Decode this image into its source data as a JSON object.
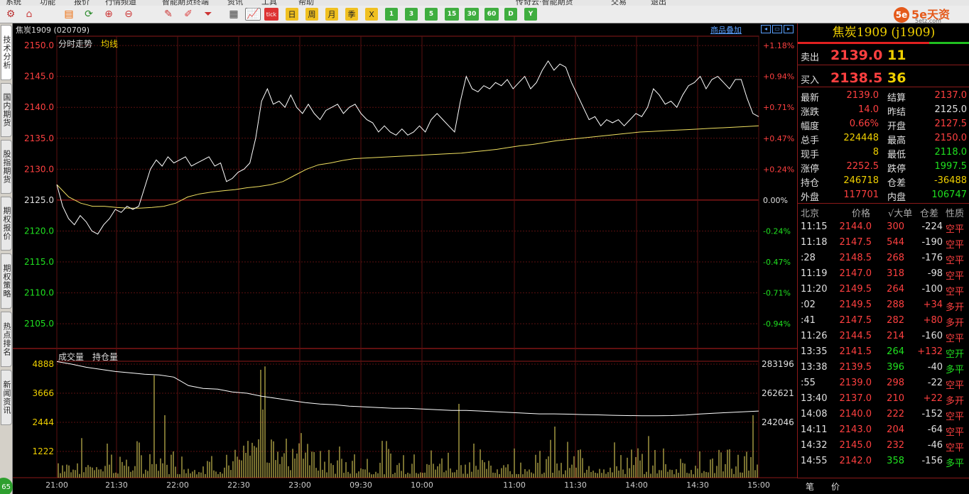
{
  "menu": [
    "系统",
    "功能",
    "报价",
    "行情频道",
    "智能期货终端",
    "资讯",
    "工具",
    "帮助",
    "传奇云·智能期货",
    "交易",
    "退出"
  ],
  "toolbar": {
    "day_buttons": [
      "日",
      "周",
      "月",
      "季",
      "X"
    ],
    "period_buttons": [
      "1",
      "3",
      "5",
      "15",
      "30",
      "60",
      "D",
      "Y"
    ],
    "tick_label": "tick"
  },
  "logo": {
    "circle": "5e",
    "name": "5e天资",
    "site": "5etz.com"
  },
  "left_tabs": [
    "技术分析",
    "国内期货",
    "股指期货",
    "期权报价",
    "期权策略",
    "热点排名",
    "新闻资讯"
  ],
  "left_tab_badge": "65",
  "chart": {
    "contract": "焦炭1909 (020709)",
    "overlay_link": "商品叠加",
    "price_title": "分时走势",
    "avg_label": "均线",
    "vol_title": "成交量",
    "oi_label": "持仓量",
    "price_ticks": [
      "2150.0",
      "2145.0",
      "2140.0",
      "2135.0",
      "2130.0",
      "2125.0",
      "2120.0",
      "2115.0",
      "2110.0",
      "2105.0"
    ],
    "pct_ticks": [
      "+1.18%",
      "+0.94%",
      "+0.71%",
      "+0.47%",
      "+0.24%",
      "0.00%",
      "-0.24%",
      "-0.47%",
      "-0.71%",
      "-0.94%"
    ],
    "vol_ticks": [
      "4888",
      "3666",
      "2444",
      "1222"
    ],
    "oi_ticks": [
      "283196",
      "262621",
      "242046"
    ],
    "time_ticks": [
      "21:00",
      "21:30",
      "22:00",
      "22:30",
      "23:00",
      "09:30",
      "10:00",
      "11:00",
      "11:30",
      "14:00",
      "14:30",
      "15:00"
    ]
  },
  "chart_data": {
    "type": "line",
    "prev_settle": 2125.0,
    "ylim": [
      2101.0,
      2151.5
    ],
    "price_series": [
      2127.5,
      2124.0,
      2122.0,
      2121.0,
      2122.5,
      2121.5,
      2120.0,
      2119.5,
      2121.0,
      2122.0,
      2123.5,
      2123.0,
      2124.0,
      2123.5,
      2124.0,
      2127.0,
      2130.0,
      2131.5,
      2130.5,
      2132.0,
      2131.0,
      2131.5,
      2132.0,
      2130.5,
      2131.0,
      2131.5,
      2132.0,
      2130.5,
      2131.0,
      2128.0,
      2128.5,
      2129.5,
      2130.0,
      2131.0,
      2135.0,
      2141.0,
      2143.0,
      2140.5,
      2141.0,
      2140.0,
      2142.0,
      2140.0,
      2139.0,
      2140.5,
      2139.0,
      2138.0,
      2139.5,
      2140.0,
      2140.5,
      2139.0,
      2140.0,
      2140.5,
      2139.0,
      2138.0,
      2137.5,
      2136.0,
      2137.0,
      2136.0,
      2135.5,
      2136.5,
      2135.5,
      2136.0,
      2137.0,
      2136.0,
      2138.0,
      2139.0,
      2138.0,
      2137.0,
      2136.0,
      2141.0,
      2145.0,
      2143.0,
      2142.5,
      2143.5,
      2143.0,
      2144.0,
      2143.5,
      2144.5,
      2143.0,
      2144.0,
      2145.0,
      2143.0,
      2144.0,
      2146.0,
      2147.5,
      2146.0,
      2147.0,
      2146.5,
      2144.0,
      2142.0,
      2140.0,
      2138.0,
      2138.5,
      2137.0,
      2138.0,
      2137.5,
      2138.0,
      2137.0,
      2138.0,
      2139.0,
      2138.5,
      2140.0,
      2143.0,
      2142.0,
      2140.5,
      2141.0,
      2140.0,
      2142.0,
      2143.5,
      2144.0,
      2145.0,
      2143.0,
      2144.5,
      2145.0,
      2144.0,
      2143.0,
      2144.5,
      2144.5,
      2141.5,
      2139.0,
      2138.5
    ],
    "avg_series": [
      2127.5,
      2125.5,
      2124.5,
      2124.0,
      2124.0,
      2123.8,
      2123.7,
      2123.7,
      2123.8,
      2124.0,
      2124.5,
      2125.5,
      2126.0,
      2126.3,
      2126.5,
      2126.7,
      2127.0,
      2127.2,
      2127.5,
      2128.0,
      2129.0,
      2130.0,
      2130.7,
      2131.0,
      2131.4,
      2131.7,
      2131.8,
      2131.9,
      2132.0,
      2132.1,
      2132.2,
      2132.3,
      2132.4,
      2132.5,
      2132.6,
      2132.8,
      2133.0,
      2133.2,
      2133.5,
      2133.8,
      2134.0,
      2134.3,
      2134.6,
      2134.8,
      2135.0,
      2135.2,
      2135.4,
      2135.6,
      2135.8,
      2136.0,
      2136.1,
      2136.2,
      2136.3,
      2136.4,
      2136.5,
      2136.6,
      2136.7,
      2136.8,
      2136.9,
      2137.0
    ],
    "price_ticks": [
      2150.0,
      2145.0,
      2140.0,
      2135.0,
      2130.0,
      2125.0,
      2120.0,
      2115.0,
      2110.0,
      2105.0
    ],
    "volume_max": 4888,
    "open_interest": [
      285000,
      283196,
      281000,
      279500,
      278000,
      277000,
      276000,
      275500,
      274000,
      268000,
      266000,
      265500,
      263500,
      262621,
      260500,
      259000,
      257500,
      256000,
      255000,
      254500,
      253500,
      253000,
      252500,
      252000,
      252000,
      251500,
      251000,
      250500,
      250500,
      250000,
      249500,
      249000,
      248500,
      248000,
      248000,
      247800,
      247500,
      247300,
      247000,
      246800,
      246700,
      246718,
      246800,
      247200,
      247900,
      248500,
      249000,
      249500,
      250000
    ]
  },
  "quote": {
    "title": "焦炭1909 (j1909)",
    "ask_label": "卖出",
    "ask_price": "2139.0",
    "ask_vol": "11",
    "bid_label": "买入",
    "bid_price": "2138.5",
    "bid_vol": "36",
    "fields": [
      {
        "l": "最新",
        "v": "2139.0",
        "vc": "#ff4040",
        "l2": "结算",
        "v2": "2137.0",
        "v2c": "#ff4040"
      },
      {
        "l": "涨跌",
        "v": "14.0",
        "vc": "#ff4040",
        "l2": "昨结",
        "v2": "2125.0",
        "v2c": "#e0e0e0"
      },
      {
        "l": "幅度",
        "v": "0.66%",
        "vc": "#ff4040",
        "l2": "开盘",
        "v2": "2127.5",
        "v2c": "#ff4040"
      },
      {
        "l": "总手",
        "v": "224448",
        "vc": "#f0d000",
        "l2": "最高",
        "v2": "2150.0",
        "v2c": "#ff4040"
      },
      {
        "l": "现手",
        "v": "8",
        "vc": "#f0d000",
        "l2": "最低",
        "v2": "2118.0",
        "v2c": "#20e020"
      },
      {
        "l": "涨停",
        "v": "2252.5",
        "vc": "#ff4040",
        "l2": "跌停",
        "v2": "1997.5",
        "v2c": "#20e020"
      },
      {
        "l": "持仓",
        "v": "246718",
        "vc": "#f0d000",
        "l2": "仓差",
        "v2": "-36488",
        "v2c": "#f0d000"
      },
      {
        "l": "外盘",
        "v": "117701",
        "vc": "#ff4040",
        "l2": "内盘",
        "v2": "106747",
        "v2c": "#20e020"
      }
    ],
    "tick_header": {
      "time": "北京",
      "price": "价格",
      "vol": "√大单",
      "oi": "仓差",
      "type": "性质"
    },
    "ticks": [
      {
        "t": "11:15",
        "p": "2144.0",
        "v": "300",
        "o": "-224",
        "n": "空平",
        "nc": "#ff4040"
      },
      {
        "t": "11:18",
        "p": "2147.5",
        "v": "544",
        "o": "-190",
        "n": "空平",
        "nc": "#ff4040"
      },
      {
        "t": ":28",
        "p": "2148.5",
        "v": "268",
        "o": "-176",
        "n": "空平",
        "nc": "#ff4040"
      },
      {
        "t": "11:19",
        "p": "2147.0",
        "v": "318",
        "o": "-98",
        "n": "空平",
        "nc": "#ff4040"
      },
      {
        "t": "11:20",
        "p": "2149.5",
        "v": "264",
        "o": "-100",
        "n": "空平",
        "nc": "#ff4040"
      },
      {
        "t": ":02",
        "p": "2149.5",
        "v": "288",
        "o": "+34",
        "n": "多开",
        "nc": "#ff4040"
      },
      {
        "t": ":41",
        "p": "2147.5",
        "v": "282",
        "o": "+80",
        "n": "多开",
        "nc": "#ff4040"
      },
      {
        "t": "11:26",
        "p": "2144.5",
        "v": "214",
        "o": "-160",
        "n": "空平",
        "nc": "#ff4040"
      },
      {
        "t": "13:35",
        "p": "2141.5",
        "v": "264",
        "o": "+132",
        "n": "空开",
        "nc": "#20e020"
      },
      {
        "t": "13:38",
        "p": "2139.5",
        "v": "396",
        "o": "-40",
        "n": "多平",
        "nc": "#20e020"
      },
      {
        "t": ":55",
        "p": "2139.0",
        "v": "298",
        "o": "-22",
        "n": "空平",
        "nc": "#ff4040"
      },
      {
        "t": "13:40",
        "p": "2137.0",
        "v": "210",
        "o": "+22",
        "n": "多开",
        "nc": "#ff4040"
      },
      {
        "t": "14:08",
        "p": "2140.0",
        "v": "222",
        "o": "-152",
        "n": "空平",
        "nc": "#ff4040"
      },
      {
        "t": "14:11",
        "p": "2143.0",
        "v": "204",
        "o": "-64",
        "n": "空平",
        "nc": "#ff4040"
      },
      {
        "t": "14:32",
        "p": "2145.0",
        "v": "232",
        "o": "-46",
        "n": "空平",
        "nc": "#ff4040"
      },
      {
        "t": "14:55",
        "p": "2142.0",
        "v": "358",
        "o": "-156",
        "n": "多平",
        "nc": "#20e020"
      }
    ],
    "bottom_tabs": [
      "笔",
      "价"
    ]
  }
}
